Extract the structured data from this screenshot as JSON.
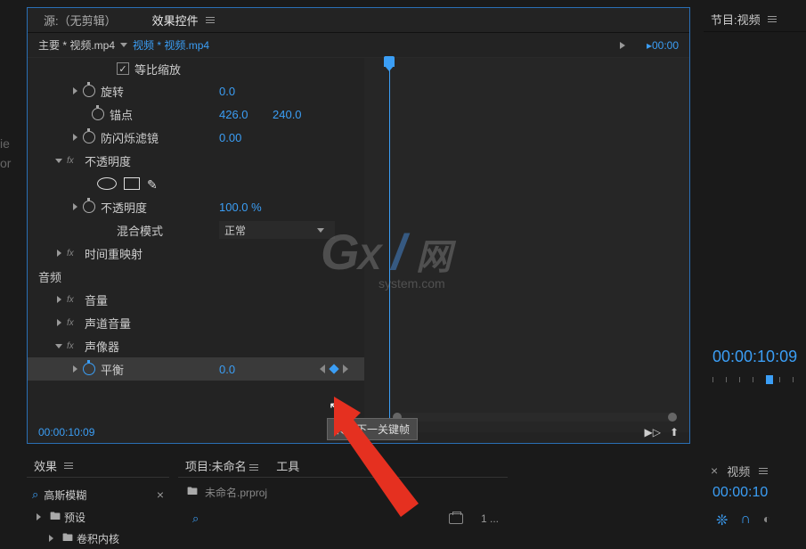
{
  "left_edge": {
    "l1": "ie",
    "l2": "or"
  },
  "tabs": {
    "source": "源:（无剪辑）",
    "effect_controls": "效果控件"
  },
  "header": {
    "main": "主要 * 视频.mp4",
    "link": "视频 * 视频.mp4",
    "time": "00:00"
  },
  "checkbox_row": {
    "label": "等比缩放"
  },
  "props": {
    "rotation": {
      "label": "旋转",
      "value": "0.0"
    },
    "anchor": {
      "label": "锚点",
      "x": "426.0",
      "y": "240.0"
    },
    "flicker": {
      "label": "防闪烁滤镜",
      "value": "0.00"
    },
    "opacity_group": "不透明度",
    "opacity": {
      "label": "不透明度",
      "value": "100.0 %"
    },
    "blend": {
      "label": "混合模式",
      "value": "正常"
    },
    "time_remap": "时间重映射",
    "audio_section": "音频",
    "volume": "音量",
    "channel_volume": "声道音量",
    "panner": "声像器",
    "balance": {
      "label": "平衡",
      "value": "0.0"
    }
  },
  "tooltip": "转到下一关键帧",
  "footer": {
    "time": "00:00:10:09"
  },
  "right_panel": {
    "tab": "节目:视频",
    "big_time": "00:00:10:09"
  },
  "bottom_right": {
    "tab": "视频",
    "time": "00:00:10"
  },
  "effects_panel": {
    "tab": "效果",
    "search": "高斯模糊",
    "preset": "预设",
    "kernel": "卷积内核"
  },
  "project_panel": {
    "tab": "项目:未命名",
    "tools": "工具",
    "crumb": "未命名.prproj",
    "count": "1 ..."
  },
  "watermark": {
    "g": "G",
    "x": "X",
    "slash": "/",
    "net": "网",
    "sub": "system.com"
  }
}
